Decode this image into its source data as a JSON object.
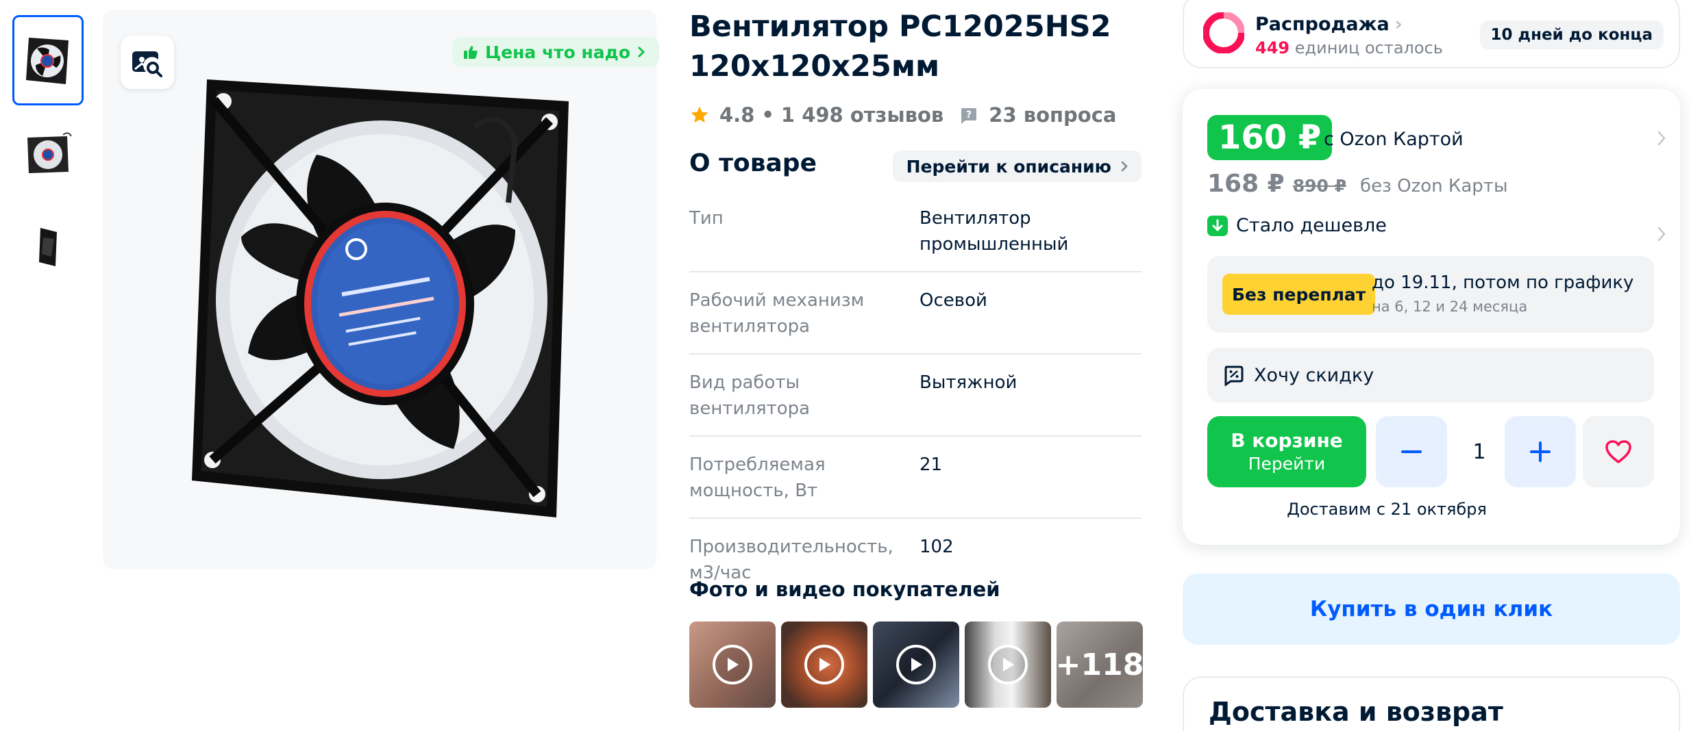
{
  "gallery": {
    "thumbnails": [
      "fan-front",
      "fan-angle",
      "fan-side"
    ],
    "price_tag": "Цена что надо"
  },
  "product": {
    "title": "Вентилятор PC12025HS2 120x120x25мм",
    "rating": "4.8",
    "separator": "•",
    "reviews": "1 498 отзывов",
    "questions": "23 вопроса"
  },
  "about": {
    "title": "О товаре",
    "goto_label": "Перейти к описанию",
    "properties": [
      {
        "key": "Тип",
        "value": "Вентилятор промышленный"
      },
      {
        "key": "Рабочий механизм вентилятора",
        "value": "Осевой"
      },
      {
        "key": "Вид работы вентилятора",
        "value": "Вытяжной"
      },
      {
        "key": "Потребляемая мощность, Вт",
        "value": "21"
      },
      {
        "key": "Производительность, м3/час",
        "value": "102"
      }
    ]
  },
  "customer_photos": {
    "title": "Фото и видео покупателей",
    "more": "+118"
  },
  "sale": {
    "name": "Распродажа",
    "units_count": "449",
    "units_text": "единиц осталось",
    "days_left": "10 дней до конца"
  },
  "pricing": {
    "card_price": "160 ₽",
    "card_label": "с Ozon Картой",
    "price": "168 ₽",
    "old_price": "890 ₽",
    "no_card_label": "без Ozon Карты",
    "cheaper_label": "Стало дешевле"
  },
  "installments": {
    "badge": "Без переплат",
    "main": "до 19.11, потом по графику",
    "sub": "на 6, 12 и 24 месяца"
  },
  "discount_label": "Хочу скидку",
  "cart": {
    "line1": "В корзине",
    "line2": "Перейти",
    "quantity": "1",
    "delivery": "Доставим с 21 октября"
  },
  "one_click_label": "Купить в один клик",
  "shipping_title": "Доставка и возврат",
  "colors": {
    "green": "#10c44c",
    "blue": "#005bff",
    "pink": "#f91155",
    "yellow": "#ffd234"
  }
}
